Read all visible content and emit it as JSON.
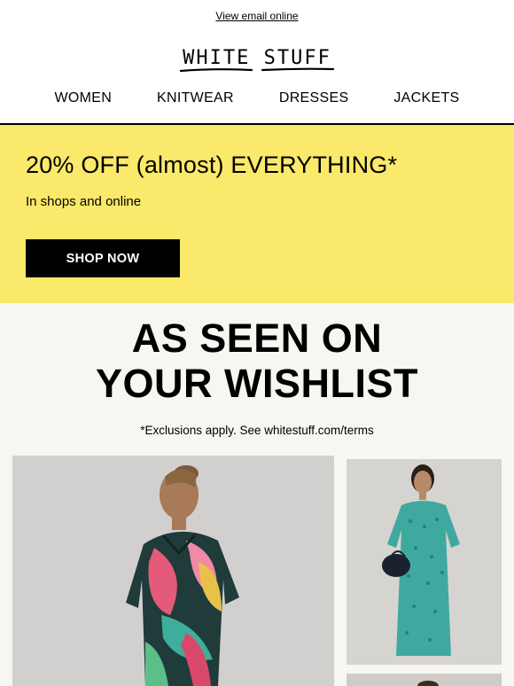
{
  "header": {
    "view_online": "View email online",
    "logo_text": "WHITE STUFF"
  },
  "nav": {
    "items": [
      {
        "label": "WOMEN"
      },
      {
        "label": "KNITWEAR"
      },
      {
        "label": "DRESSES"
      },
      {
        "label": "JACKETS"
      }
    ]
  },
  "promo": {
    "title": "20% OFF (almost) EVERYTHING*",
    "subtitle": "In shops and online",
    "button_label": "SHOP NOW",
    "background_color": "#fae96a"
  },
  "wishlist": {
    "title_line1": "AS SEEN ON",
    "title_line2": "YOUR WISHLIST",
    "exclusions": "*Exclusions apply. See whitestuff.com/terms",
    "background_color": "#f8f6f1"
  },
  "products": [
    {
      "image": "model-in-green-pink-leaf-print-shirt-dress"
    },
    {
      "image": "model-in-teal-geometric-print-midi-dress"
    },
    {
      "image": "partial-product-image"
    }
  ]
}
